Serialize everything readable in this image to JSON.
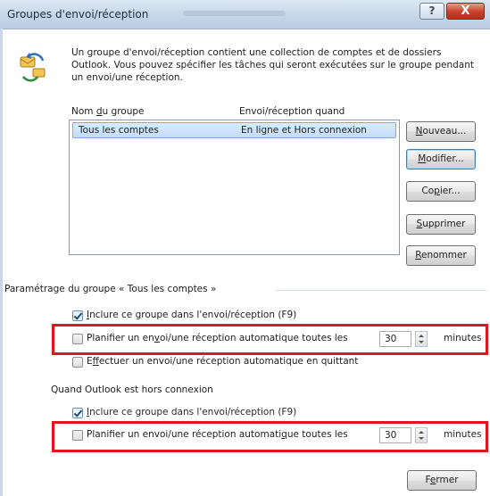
{
  "window": {
    "title": "Groupes d'envoi/réception",
    "help_label": "?",
    "close_label": "X"
  },
  "intro": {
    "text": "Un groupe d'envoi/réception contient une collection de comptes et de dossiers Outlook. Vous pouvez spécifier les tâches qui seront exécutées sur le groupe pendant un envoi/une réception."
  },
  "groups_table": {
    "columns": [
      "Nom du groupe",
      "Envoi/réception quand"
    ],
    "rows": [
      {
        "name": "Tous les comptes",
        "when": "En ligne et Hors connexion",
        "selected": true
      }
    ]
  },
  "buttons": {
    "new": "Nouveau...",
    "modify": "Modifier...",
    "copy": "Copier...",
    "delete": "Supprimer",
    "rename": "Renommer",
    "close": "Fermer"
  },
  "group_settings": {
    "title": "Paramétrage du groupe « Tous les comptes »",
    "online": {
      "include": {
        "label": "Inclure ce groupe dans l'envoi/réception (F9)",
        "checked": true
      },
      "schedule": {
        "label": "Planifier un envoi/une réception automatique toutes les",
        "checked": false,
        "value": "30",
        "unit": "minutes"
      },
      "on_exit": {
        "label": "Effectuer un envoi/une réception automatique en quittant",
        "checked": false
      }
    },
    "offline_title": "Quand Outlook est hors connexion",
    "offline": {
      "include": {
        "label": "Inclure ce groupe dans l'envoi/réception (F9)",
        "checked": true
      },
      "schedule": {
        "label": "Planifier un envoi/une réception automatique toutes les",
        "checked": false,
        "value": "30",
        "unit": "minutes"
      }
    }
  },
  "icons": {
    "intro": "send-receive-icon",
    "help": "question-icon",
    "close": "close-icon"
  },
  "colors": {
    "highlight": "#e0161b",
    "selected_row": "#c3dcf6",
    "title_bar": "#c6d7ea"
  }
}
